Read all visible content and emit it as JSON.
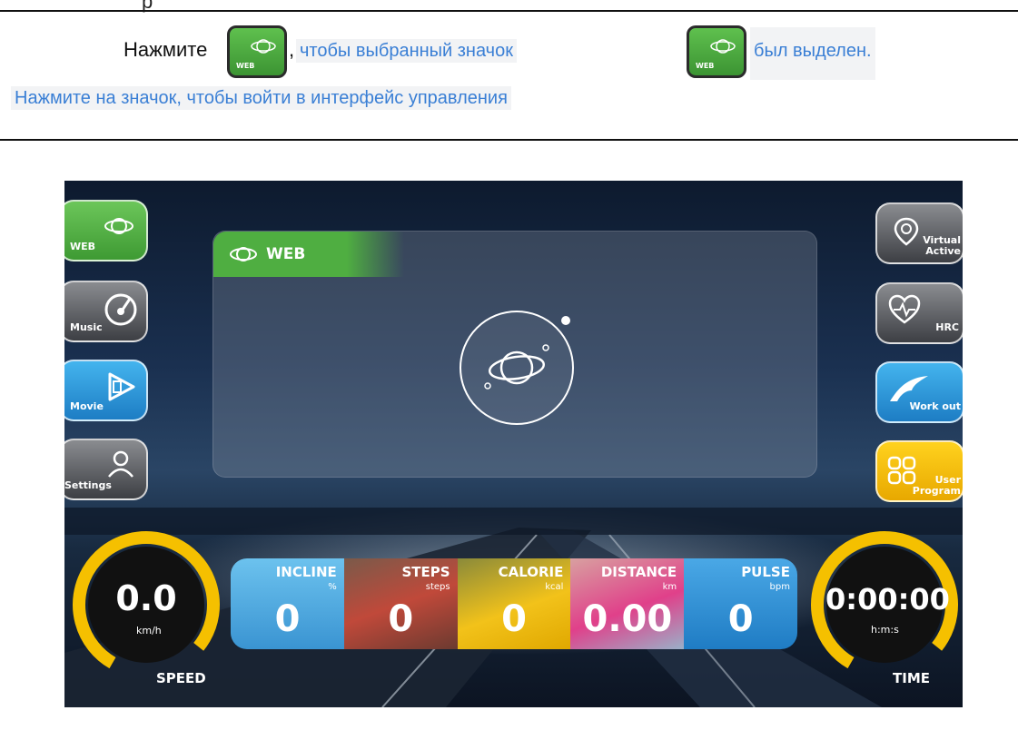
{
  "instruction": {
    "top_fragment": "р",
    "line1_prefix": "Нажмите",
    "line1_comma": ",",
    "line1_mid": "чтобы выбранный значок",
    "line1_end": "был выделен.",
    "line2": "Нажмите на значок, чтобы войти в интерфейс управления",
    "mini_icon_label": "WEB"
  },
  "screen": {
    "left_menu": [
      {
        "label": "WEB",
        "icon": "planet-icon",
        "state": "selected"
      },
      {
        "label": "Music",
        "icon": "music-disc-icon"
      },
      {
        "label": "Movie",
        "icon": "film-play-icon"
      },
      {
        "label": "Settings",
        "icon": "user-settings-icon"
      }
    ],
    "right_menu": [
      {
        "label_line1": "Virtual",
        "label_line2": "Active",
        "icon": "map-pin-icon"
      },
      {
        "label_line1": "HRC",
        "label_line2": "",
        "icon": "heart-pulse-icon"
      },
      {
        "label_line1": "Work out",
        "label_line2": "",
        "icon": "wave-icon"
      },
      {
        "label_line1": "User",
        "label_line2": "Program",
        "icon": "grid-icon"
      }
    ],
    "web_panel": {
      "title": "WEB",
      "icon": "planet-icon"
    },
    "speed": {
      "value": "0.0",
      "unit": "km/h",
      "name": "SPEED"
    },
    "time": {
      "value": "0:00:00",
      "unit": "h:m:s",
      "name": "TIME"
    },
    "stats": [
      {
        "title": "INCLINE",
        "unit": "%",
        "value": "0",
        "color": "#4aa8e0"
      },
      {
        "title": "STEPS",
        "unit": "steps",
        "value": "0",
        "color": "#b0392a"
      },
      {
        "title": "CALORIE",
        "unit": "kcal",
        "value": "0",
        "color": "#f2c21a"
      },
      {
        "title": "DISTANCE",
        "unit": "km",
        "value": "0.00",
        "color": "#e0408a"
      },
      {
        "title": "PULSE",
        "unit": "bpm",
        "value": "0",
        "color": "#2f8fd6"
      }
    ],
    "colors": {
      "accent_green": "#4fae41",
      "gauge_yellow": "#f5c000",
      "link_blue": "#3a7fd5"
    }
  }
}
